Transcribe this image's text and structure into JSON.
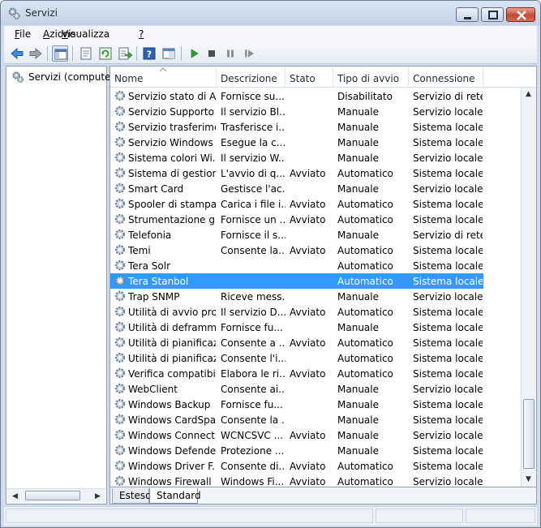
{
  "window": {
    "title": "Servizi"
  },
  "menu": [
    {
      "prefix": "",
      "accel": "F",
      "rest": "ile"
    },
    {
      "prefix": "",
      "accel": "A",
      "rest": "zione"
    },
    {
      "prefix": "",
      "accel": "V",
      "rest": "isualizza"
    },
    {
      "prefix": "",
      "accel": "?",
      "rest": ""
    }
  ],
  "toolbar": [
    "back-arrow-icon",
    "forward-arrow-icon",
    "show-hide-tree-icon",
    "properties-icon",
    "refresh-icon",
    "export-list-icon",
    "help-icon",
    "console-view-icon",
    "start-service-icon",
    "stop-service-icon",
    "pause-service-icon",
    "restart-service-icon"
  ],
  "tree": {
    "label": "Servizi (computer"
  },
  "columns": [
    "Nome",
    "Descrizione",
    "Stato",
    "Tipo di avvio",
    "Connessione"
  ],
  "services": [
    {
      "name": "Servizio stato di A...",
      "desc": "Fornisce su...",
      "stato": "",
      "tipo": "Disabilitato",
      "conn": "Servizio di rete"
    },
    {
      "name": "Servizio Supporto ...",
      "desc": "Il servizio Bl...",
      "stato": "",
      "tipo": "Manuale",
      "conn": "Servizio locale"
    },
    {
      "name": "Servizio trasferime...",
      "desc": "Trasferisce i...",
      "stato": "",
      "tipo": "Manuale",
      "conn": "Sistema locale"
    },
    {
      "name": "Servizio Windows ...",
      "desc": "Esegue la c...",
      "stato": "",
      "tipo": "Manuale",
      "conn": "Sistema locale"
    },
    {
      "name": "Sistema colori Wi...",
      "desc": "Il servizio W...",
      "stato": "",
      "tipo": "Manuale",
      "conn": "Servizio locale"
    },
    {
      "name": "Sistema di gestion...",
      "desc": "L'avvio di q...",
      "stato": "Avviato",
      "tipo": "Automatico",
      "conn": "Sistema locale"
    },
    {
      "name": "Smart Card",
      "desc": "Gestisce l'ac...",
      "stato": "",
      "tipo": "Manuale",
      "conn": "Servizio locale"
    },
    {
      "name": "Spooler di stampa",
      "desc": "Carica i file i...",
      "stato": "Avviato",
      "tipo": "Automatico",
      "conn": "Sistema locale"
    },
    {
      "name": "Strumentazione g...",
      "desc": "Fornisce un ...",
      "stato": "Avviato",
      "tipo": "Automatico",
      "conn": "Sistema locale"
    },
    {
      "name": "Telefonia",
      "desc": "Fornisce il s...",
      "stato": "",
      "tipo": "Manuale",
      "conn": "Servizio di rete"
    },
    {
      "name": "Temi",
      "desc": "Consente la...",
      "stato": "Avviato",
      "tipo": "Automatico",
      "conn": "Sistema locale"
    },
    {
      "name": "Tera Solr",
      "desc": "",
      "stato": "",
      "tipo": "Automatico",
      "conn": "Sistema locale"
    },
    {
      "name": "Tera Stanbol",
      "desc": "",
      "stato": "",
      "tipo": "Automatico",
      "conn": "Sistema locale",
      "selected": true
    },
    {
      "name": "Trap SNMP",
      "desc": "Riceve mess...",
      "stato": "",
      "tipo": "Manuale",
      "conn": "Servizio locale"
    },
    {
      "name": "Utilità di avvio pro...",
      "desc": "Il servizio D...",
      "stato": "Avviato",
      "tipo": "Automatico",
      "conn": "Sistema locale"
    },
    {
      "name": "Utilità di deframm...",
      "desc": "Fornisce fu...",
      "stato": "",
      "tipo": "Manuale",
      "conn": "Sistema locale"
    },
    {
      "name": "Utilità di pianificaz...",
      "desc": "Consente a ...",
      "stato": "Avviato",
      "tipo": "Automatico",
      "conn": "Sistema locale"
    },
    {
      "name": "Utilità di pianificaz...",
      "desc": "Consente l'i...",
      "stato": "",
      "tipo": "Automatico",
      "conn": "Sistema locale"
    },
    {
      "name": "Verifica compatibi...",
      "desc": "Elabora le ri...",
      "stato": "Avviato",
      "tipo": "Automatico",
      "conn": "Sistema locale"
    },
    {
      "name": "WebClient",
      "desc": "Consente ai...",
      "stato": "",
      "tipo": "Manuale",
      "conn": "Servizio locale"
    },
    {
      "name": "Windows Backup",
      "desc": "Fornisce fu...",
      "stato": "",
      "tipo": "Manuale",
      "conn": "Sistema locale"
    },
    {
      "name": "Windows CardSpa...",
      "desc": "Consente la ...",
      "stato": "",
      "tipo": "Manuale",
      "conn": "Sistema locale"
    },
    {
      "name": "Windows Connect...",
      "desc": "WCNCSVC ...",
      "stato": "Avviato",
      "tipo": "Manuale",
      "conn": "Servizio locale"
    },
    {
      "name": "Windows Defender",
      "desc": "Protezione ...",
      "stato": "",
      "tipo": "Manuale",
      "conn": "Sistema locale"
    },
    {
      "name": "Windows Driver F...",
      "desc": "Consente di...",
      "stato": "Avviato",
      "tipo": "Automatico",
      "conn": "Sistema locale"
    },
    {
      "name": "Windows Firewall",
      "desc": "Windows Fi...",
      "stato": "Avviato",
      "tipo": "Automatico",
      "conn": "Servizio locale"
    }
  ],
  "tabs": [
    "Esteso",
    "Standard"
  ],
  "colors": {
    "selection": "#3399ff",
    "chrome": "#cfdcec"
  }
}
